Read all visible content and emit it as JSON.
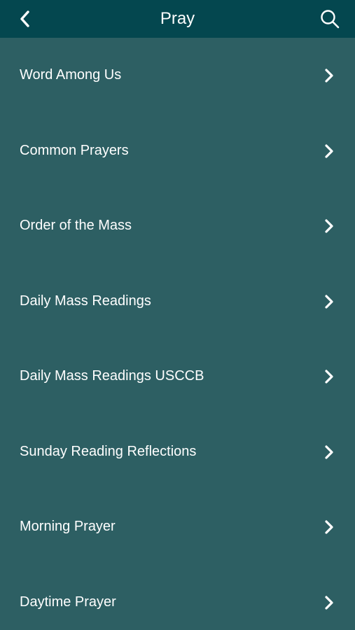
{
  "header": {
    "title": "Pray",
    "back_icon": "chevron-left-icon",
    "search_icon": "search-icon"
  },
  "menu": {
    "items": [
      {
        "label": "Word Among Us"
      },
      {
        "label": "Common Prayers"
      },
      {
        "label": "Order of the Mass"
      },
      {
        "label": "Daily Mass Readings"
      },
      {
        "label": "Daily Mass Readings USCCB"
      },
      {
        "label": "Sunday Reading Reflections"
      },
      {
        "label": "Morning Prayer"
      },
      {
        "label": "Daytime Prayer"
      }
    ],
    "chevron_icon": "chevron-right-icon"
  },
  "colors": {
    "header_background": "#04474f",
    "list_background": "#2d5f63",
    "text": "#ffffff"
  }
}
